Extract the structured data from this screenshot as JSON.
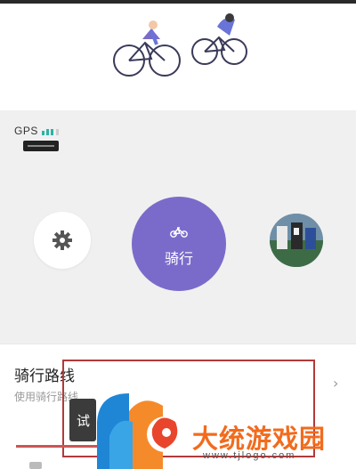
{
  "status": {
    "gps_label": "GPS"
  },
  "actions": {
    "start_label": "骑行"
  },
  "route": {
    "title": "骑行路线",
    "subtitle": "使用骑行路线"
  },
  "overlay": {
    "dark_button_char": "试",
    "brand_text": "大统游戏园",
    "url_text": "www.tjlogo.com"
  },
  "colors": {
    "accent": "#7a6bcb",
    "brand_orange": "#f26b1d"
  },
  "icons": {
    "settings": "gear-icon",
    "start": "bicycle-icon"
  }
}
